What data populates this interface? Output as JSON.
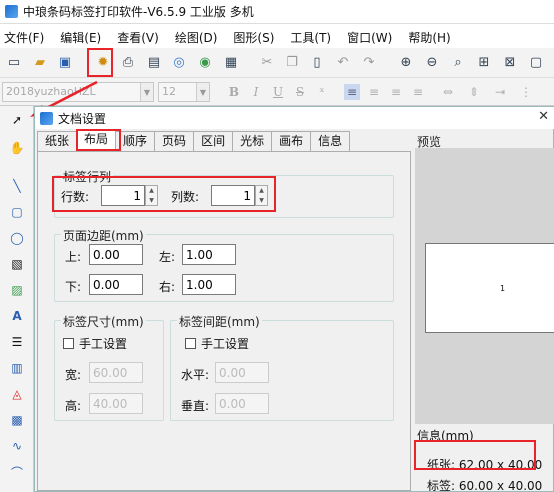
{
  "app": {
    "title": "中琅条码标签打印软件-V6.5.9 工业版 多机"
  },
  "menu": [
    "文件(F)",
    "编辑(E)",
    "查看(V)",
    "绘图(D)",
    "图形(S)",
    "工具(T)",
    "窗口(W)",
    "帮助(H)"
  ],
  "fontbar": {
    "font_name": "2018yuzhaoHZL",
    "font_size": "12",
    "bold": "B",
    "italic": "I",
    "underline": "U",
    "strike": "S"
  },
  "dialog": {
    "title": "文档设置",
    "tabs": [
      "纸张",
      "布局",
      "顺序",
      "页码",
      "区间",
      "光标",
      "画布",
      "信息"
    ],
    "active_tab": "布局",
    "label_grid": {
      "legend": "标签行列",
      "rows_label": "行数:",
      "rows_value": "1",
      "cols_label": "列数:",
      "cols_value": "1"
    },
    "margins": {
      "legend": "页面边距(mm)",
      "top_label": "上:",
      "top_value": "0.00",
      "left_label": "左:",
      "left_value": "1.00",
      "bottom_label": "下:",
      "bottom_value": "0.00",
      "right_label": "右:",
      "right_value": "1.00"
    },
    "label_size": {
      "legend": "标签尺寸(mm)",
      "manual_label": "手工设置",
      "manual_checked": false,
      "width_label": "宽:",
      "width_value": "60.00",
      "height_label": "高:",
      "height_value": "40.00"
    },
    "label_gap": {
      "legend": "标签间距(mm)",
      "manual_label": "手工设置",
      "manual_checked": false,
      "h_label": "水平:",
      "h_value": "0.00",
      "v_label": "垂直:",
      "v_value": "0.00"
    },
    "preview": {
      "title": "预览",
      "label_number": "1"
    },
    "info": {
      "title": "信息(mm)",
      "paper_label": "纸张:",
      "paper_value": "62.00 x 40.00",
      "label_label": "标签:",
      "label_value": "60.00 x 40.00"
    }
  },
  "colors": {
    "highlight": "#e8232a",
    "accent": "#1b6fd1"
  }
}
